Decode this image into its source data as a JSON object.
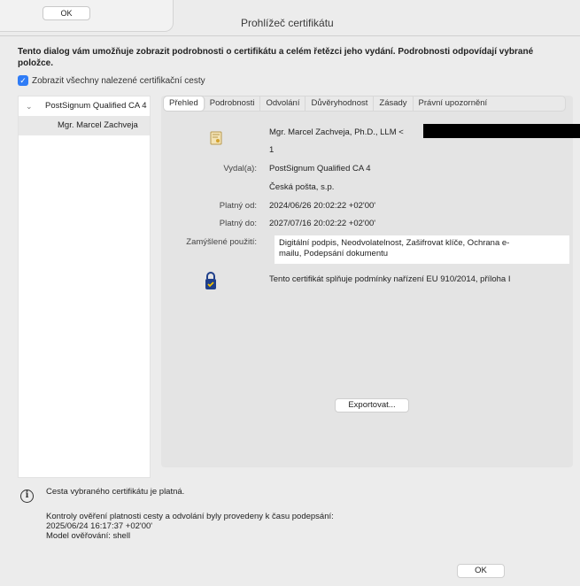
{
  "background_dialog": {
    "ok_label": "OK"
  },
  "window": {
    "title": "Prohlížeč certifikátu"
  },
  "description": "Tento dialog vám umožňuje zobrazit podrobnosti o certifikátu a celém řetězci jeho vydání. Podrobnosti odpovídají vybrané položce.",
  "show_all_paths": {
    "label": "Zobrazit všechny nalezené certifikační cesty",
    "checked": true
  },
  "tree": {
    "items": [
      {
        "label": "PostSignum Qualified CA 4",
        "level": 0
      },
      {
        "label": "Mgr. Marcel Zachveja",
        "level": 1
      }
    ]
  },
  "tabs": [
    {
      "label": "Přehled",
      "active": true
    },
    {
      "label": "Podrobnosti"
    },
    {
      "label": "Odvolání"
    },
    {
      "label": "Důvěryhodnost"
    },
    {
      "label": "Zásady"
    },
    {
      "label": "Právní upozornění"
    }
  ],
  "summary": {
    "subject": "Mgr. Marcel Zachveja, Ph.D., LLM <",
    "serial": "1",
    "issued_by_label": "Vydal(a):",
    "issued_by": "PostSignum Qualified CA 4",
    "issuer_org": "Česká pošta, s.p.",
    "valid_from_label": "Platný od:",
    "valid_from": "2024/06/26 20:02:22 +02'00'",
    "valid_to_label": "Platný do:",
    "valid_to": "2027/07/16 20:02:22 +02'00'",
    "intended_use_label": "Zamýšlené použití:",
    "intended_use_line1": "Digitální podpis, Neodvolatelnost, Zašifrovat klíče, Ochrana e-",
    "intended_use_line2": "mailu, Podepsání dokumentu",
    "compliance": "Tento certifikát splňuje podmínky nařízení EU 910/2014, příloha I"
  },
  "export_label": "Exportovat...",
  "status": {
    "main": "Cesta vybraného certifikátu je platná.",
    "line1": "Kontroly ověření platnosti cesty a odvolání byly provedeny k času podepsání:",
    "line2": "2025/06/24 16:17:37 +02'00'",
    "line3": "Model ověřování: shell"
  },
  "ok_label": "OK",
  "colors": {
    "accent": "#2f7cf6",
    "redaction": "#000000"
  }
}
